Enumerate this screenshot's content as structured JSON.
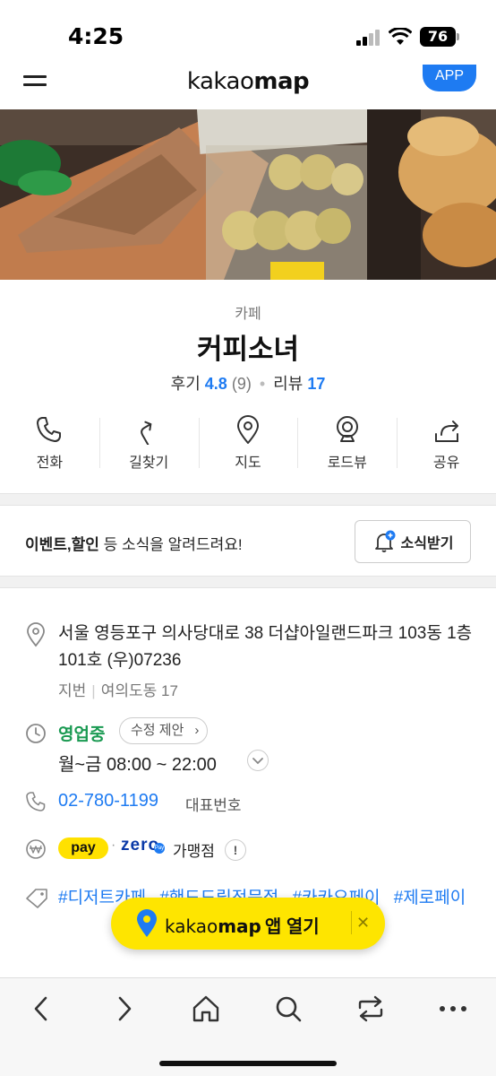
{
  "status_bar": {
    "time": "4:25",
    "battery": "76"
  },
  "header": {
    "logo_light": "kakao",
    "logo_bold": "map",
    "app_button": "APP"
  },
  "place": {
    "category": "카페",
    "name": "커피소녀",
    "rating_label": "후기",
    "rating_value": "4.8",
    "rating_count": "(9)",
    "review_label": "리뷰",
    "review_count": "17"
  },
  "actions": [
    {
      "label": "전화",
      "icon": "phone-icon"
    },
    {
      "label": "길찾기",
      "icon": "directions-icon"
    },
    {
      "label": "지도",
      "icon": "map-pin-icon"
    },
    {
      "label": "로드뷰",
      "icon": "roadview-icon"
    },
    {
      "label": "공유",
      "icon": "share-icon"
    }
  ],
  "news": {
    "text_bold": "이벤트,할인",
    "text_rest": " 등 소식을 알려드려요!",
    "subscribe_label": "소식받기"
  },
  "details": {
    "address": "서울 영등포구 의사당대로 38 더샵아일랜드파크 103동 1층 101호 (우)07236",
    "lot_label": "지번",
    "lot_address": "여의도동 17",
    "open_status": "영업중",
    "edit_suggest": "수정 제안",
    "hours": "월~금 08:00 ~ 22:00",
    "phone": "02-780-1199",
    "phone_label": "대표번호",
    "pay_badge": "pay",
    "zeropay": "zero",
    "zeropay_mark": "Pay",
    "affiliate_label": "가맹점",
    "info_mark": "!",
    "tags": [
      "#디저트카페",
      "#핸드드립전문점",
      "#카카오페이",
      "#제로페이"
    ]
  },
  "open_app": {
    "brand_light": "kakao",
    "brand_bold": "map",
    "label": "앱 열기",
    "close": "✕"
  },
  "colors": {
    "accent_blue": "#1e7bf2",
    "open_green": "#1a9a52",
    "kakao_yellow": "#fee500"
  }
}
